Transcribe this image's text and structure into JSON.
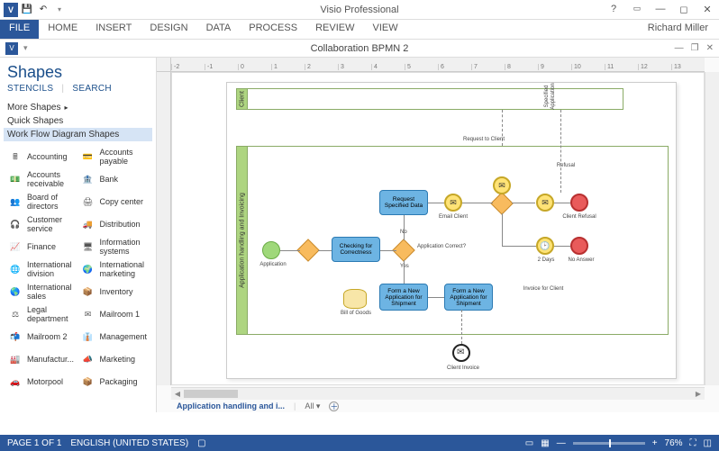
{
  "app": {
    "title": "Visio Professional",
    "user": "Richard Miller"
  },
  "ribbon": {
    "tabs": [
      "FILE",
      "HOME",
      "INSERT",
      "DESIGN",
      "DATA",
      "PROCESS",
      "REVIEW",
      "VIEW"
    ]
  },
  "document": {
    "title": "Collaboration BPMN 2"
  },
  "shapes_panel": {
    "title": "Shapes",
    "tab_stencils": "STENCILS",
    "tab_search": "SEARCH",
    "more": "More Shapes",
    "quick": "Quick Shapes",
    "selected_stencil": "Work Flow Diagram Shapes",
    "items": [
      {
        "label": "Accounting"
      },
      {
        "label": "Accounts payable"
      },
      {
        "label": "Accounts receivable"
      },
      {
        "label": "Bank"
      },
      {
        "label": "Board of directors"
      },
      {
        "label": "Copy center"
      },
      {
        "label": "Customer service"
      },
      {
        "label": "Distribution"
      },
      {
        "label": "Finance"
      },
      {
        "label": "Information systems"
      },
      {
        "label": "International division"
      },
      {
        "label": "International marketing"
      },
      {
        "label": "International sales"
      },
      {
        "label": "Inventory"
      },
      {
        "label": "Legal department"
      },
      {
        "label": "Mailroom 1"
      },
      {
        "label": "Mailroom 2"
      },
      {
        "label": "Management"
      },
      {
        "label": "Manufactur..."
      },
      {
        "label": "Marketing"
      },
      {
        "label": "Motorpool"
      },
      {
        "label": "Packaging"
      }
    ]
  },
  "ruler_h": [
    "-2",
    "-1",
    "0",
    "1",
    "2",
    "3",
    "4",
    "5",
    "6",
    "7",
    "8",
    "9",
    "10",
    "11",
    "12",
    "13"
  ],
  "diagram": {
    "pool_client": "Client",
    "pool_main": "Application handling and Invoicing",
    "start_label": "Application",
    "task_check": "Checking for Correctness",
    "task_request": "Request Specified Data",
    "task_form1": "Form a New Application for Shipment",
    "task_form2": "Form a New Application for Shipment",
    "data_label": "Bill of Goods",
    "msg_request_to_client": "Request to Client",
    "msg_specified_application": "Specified Application",
    "q_correct": "Application Correct?",
    "yes": "Yes",
    "no": "No",
    "email_client": "Email Client",
    "two_days": "2 Days",
    "refusal": "Refusal",
    "client_refusal": "Client Refusal",
    "no_answer": "No Answer",
    "invoice_for_client": "Invoice for Client",
    "client_invoice": "Client Invoice"
  },
  "page_tabs": {
    "active": "Application handling and i...",
    "all": "All",
    "add": "+"
  },
  "status": {
    "page": "PAGE 1 OF 1",
    "lang": "ENGLISH (UNITED STATES)",
    "zoom": "76%"
  }
}
